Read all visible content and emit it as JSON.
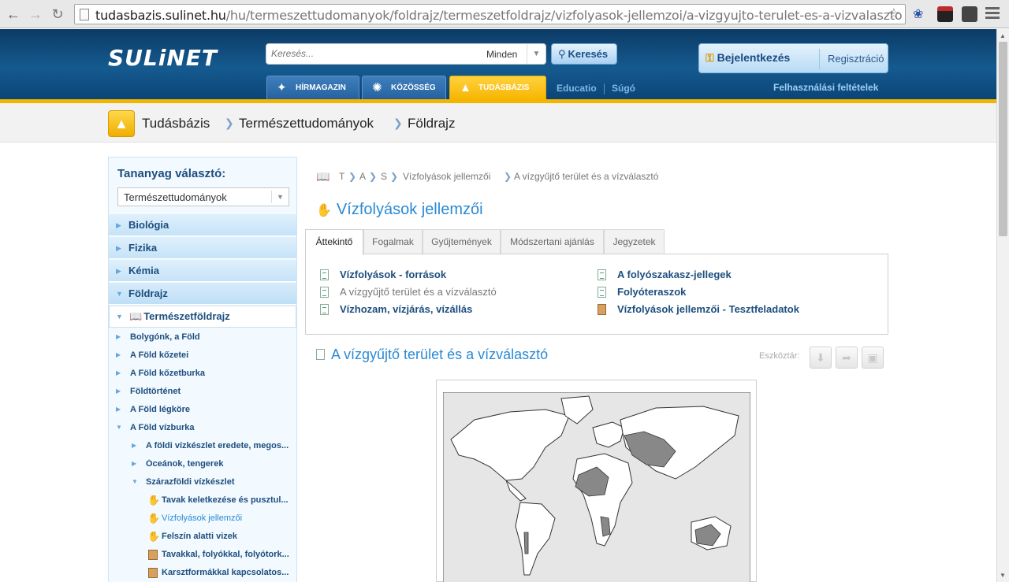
{
  "browser": {
    "url_host": "tudasbazis.sulinet.hu",
    "url_path": "/hu/termeszettudomanyok/foldrajz/termeszetfoldrajz/vizfolyasok-jellemzoi/a-vizgyujto-terulet-es-a-vizvalaszto"
  },
  "header": {
    "logo": "SULiNET",
    "search_placeholder": "Keresés...",
    "search_scope": "Minden",
    "search_button": "Keresés",
    "login": "Bejelentkezés",
    "register": "Regisztráció",
    "terms": "Felhasználási feltételek",
    "tabs": [
      "HÍRMAGAZIN",
      "KÖZÖSSÉG",
      "TUDÁSBÁZIS"
    ],
    "links": [
      "Educatio",
      "Súgó"
    ]
  },
  "breadcrumb": [
    "Tudásbázis",
    "Természettudományok",
    "Földrajz"
  ],
  "sidebar": {
    "title": "Tananyag választó:",
    "select_value": "Természettudományok",
    "categories": [
      "Biológia",
      "Fizika",
      "Kémia",
      "Földrajz"
    ],
    "subcategory": "Természetföldrajz",
    "tree": [
      "Bolygónk, a Föld",
      "A Föld kőzetei",
      "A Föld kőzetburka",
      "Földtörténet",
      "A Föld légköre",
      "A Föld vízburka",
      "A földi vízkészlet eredete, megos...",
      "Óceánok, tengerek",
      "Szárazföldi vízkészlet",
      "Tavak keletkezése és pusztul...",
      "Vízfolyások jellemzői",
      "Felszín alatti vizek",
      "Tavakkal, folyókkal, folyótork...",
      "Karsztformákkal kapcsolatos..."
    ]
  },
  "content": {
    "crumbs": [
      "T",
      "A",
      "S",
      "Vízfolyások jellemzői",
      "A vízgyűjtő terület és a vízválasztó"
    ],
    "page_title": "Vízfolyások jellemzői",
    "tabs": [
      "Áttekintő",
      "Fogalmak",
      "Gyűjtemények",
      "Módszertani ajánlás",
      "Jegyzetek"
    ],
    "topics_left": [
      "Vízfolyások - források",
      "A vízgyűjtő terület és a vízválasztó",
      "Vízhozam, vízjárás, vízállás"
    ],
    "topics_right": [
      "A folyószakasz-jellegek",
      "Folyóteraszok",
      "Vízfolyások jellemzői - Tesztfeladatok"
    ],
    "article_title": "A vízgyűjtő terület és a vízválasztó",
    "toolbar_label": "Eszköztár:"
  },
  "icons": {
    "toolbar": [
      "download-icon",
      "share-icon",
      "bookmark-icon"
    ]
  }
}
